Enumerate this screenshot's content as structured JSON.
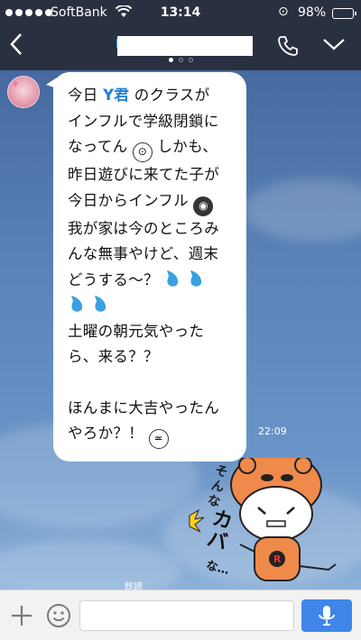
{
  "status_bar": {
    "carrier": "SoftBank",
    "time": "13:14",
    "battery": "98%"
  },
  "header": {
    "back_icon": "chevron-left-icon",
    "call_icon": "phone-icon",
    "menu_icon": "chevron-down-icon",
    "page_indicator": {
      "count": 3,
      "active": 0
    }
  },
  "message": {
    "lines": [
      [
        "今日",
        "Y君",
        "のクラスが"
      ],
      [
        "インフルで学級閉鎖に"
      ],
      [
        "なってん",
        "しかも、"
      ],
      [
        "昨日遊びに来てた子が"
      ],
      [
        "今日からインフル"
      ],
      [
        "我が家は今のところみ"
      ],
      [
        "んな無事やけど、週末"
      ],
      [
        "どうする～？"
      ],
      [
        "土曜の朝元気やった"
      ],
      [
        "ら、来る？？"
      ],
      [
        "ほんまに大吉やったん"
      ],
      [
        "やろか？！"
      ]
    ],
    "time": "22:09",
    "read_label": "既読"
  },
  "sticker": {
    "text": "そんなカバな…",
    "name": "hippo-costume-sticker"
  },
  "input": {
    "placeholder": "",
    "value": ""
  },
  "colors": {
    "bar": "#29303f",
    "bubble": "#ffffff",
    "highlight": "#1f7ed8",
    "send": "#3f86e8"
  }
}
